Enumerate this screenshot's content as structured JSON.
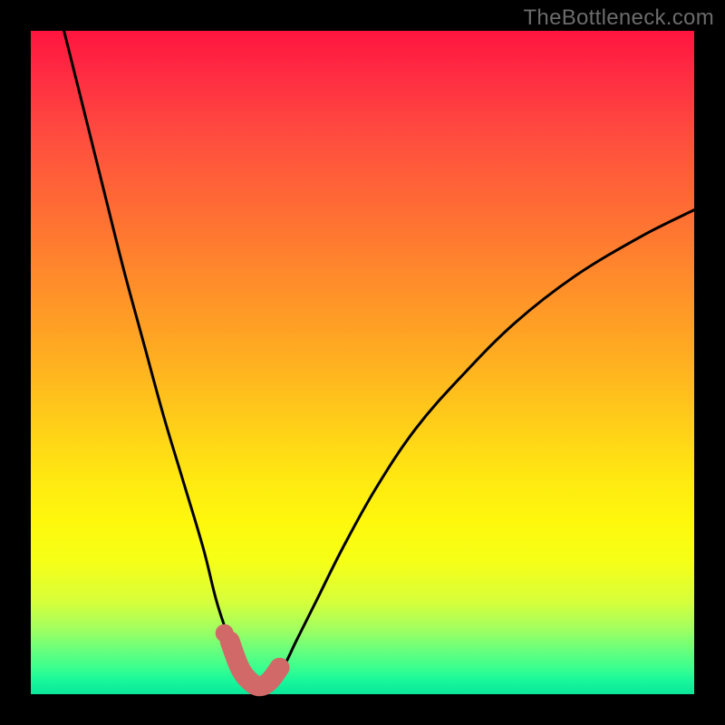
{
  "watermark": "TheBottleneck.com",
  "chart_data": {
    "type": "line",
    "title": "",
    "xlabel": "",
    "ylabel": "",
    "xlim": [
      0,
      100
    ],
    "ylim": [
      0,
      100
    ],
    "series": [
      {
        "name": "bottleneck-curve",
        "x": [
          5,
          8,
          11,
          14,
          17,
          20,
          23,
          26,
          28,
          30,
          31.5,
          33,
          34.5,
          36,
          38,
          40,
          43,
          47,
          52,
          58,
          65,
          73,
          82,
          92,
          100
        ],
        "y": [
          100,
          88,
          76,
          64,
          53,
          42,
          32,
          22,
          14,
          8,
          4,
          2,
          1.2,
          2,
          4,
          8,
          14,
          22,
          31,
          40,
          48,
          56,
          63,
          69,
          73
        ]
      }
    ],
    "highlight": {
      "name": "optimal-zone",
      "x": [
        30,
        31.5,
        33,
        34.5,
        36,
        37.5
      ],
      "y": [
        8,
        4,
        2,
        1.2,
        2,
        4
      ]
    },
    "highlight_dot": {
      "x": 29.2,
      "y": 9.2
    },
    "gradient_stops": [
      {
        "pos": 0,
        "color": "#ff153e"
      },
      {
        "pos": 50,
        "color": "#ffaa22"
      },
      {
        "pos": 75,
        "color": "#fef80d"
      },
      {
        "pos": 100,
        "color": "#0be79a"
      }
    ]
  }
}
